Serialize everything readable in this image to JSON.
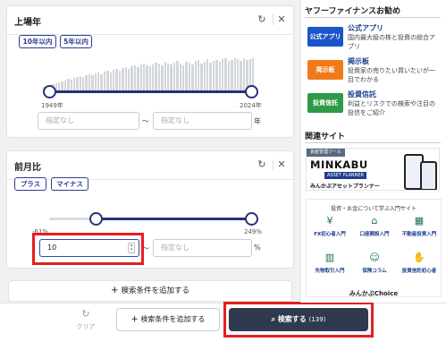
{
  "listing_year": {
    "title": "上場年",
    "chips": [
      "10年以内",
      "5年以内"
    ],
    "min_label": "1949年",
    "max_label": "2024年",
    "from_placeholder": "指定なし",
    "separator": "〜",
    "to_placeholder": "指定なし",
    "unit": "年",
    "reset_icon": "reset-icon",
    "close_icon": "close-icon"
  },
  "prev_month_ratio": {
    "title": "前月比",
    "chips": [
      "プラス",
      "マイナス"
    ],
    "min_label": "-61%",
    "max_label": "249%",
    "from_value": "10",
    "separator": "〜",
    "to_placeholder": "指定なし",
    "unit": "%"
  },
  "add_condition_label": "検索条件を追加する",
  "bottom_bar": {
    "clear_label": "クリア",
    "add_condition_label": "検索条件を追加する",
    "search_label": "検索する",
    "search_count": "(139)"
  },
  "sidebar": {
    "title": "ヤフーファイナンスお勧め",
    "services": [
      {
        "icon_label": "公式アプリ",
        "title": "公式アプリ",
        "desc": "国内最大級の株と投資の総合アプリ",
        "color": "#1a56c9"
      },
      {
        "icon_label": "掲示板",
        "title": "掲示板",
        "desc": "投資家の売りたい買いたいが一目でわかる",
        "color": "#f07a1a"
      },
      {
        "icon_label": "投資信託",
        "title": "投資信託",
        "desc": "利益とリスクでの検索や注目の投信をご紹介",
        "color": "#2e9a47"
      }
    ],
    "related_title": "関連サイト",
    "banner": {
      "tag": "資産管理ツール",
      "brand": "MINKABU",
      "sub": "ASSET PLANNER",
      "caption": "みんかぶアセットプランナー"
    },
    "learn_title": "投資・お金について学ぶ入門サイト",
    "learn_items": [
      "FX初心者入門",
      "口座開設入門",
      "不動産投資入門",
      "先物取引入門",
      "保険コラム",
      "投資信託初心者"
    ],
    "choice_label": "みんかぶChoice"
  },
  "colors": {
    "accent": "#25337a",
    "highlight": "#e41f1f",
    "search_button": "#2f3a4f"
  }
}
